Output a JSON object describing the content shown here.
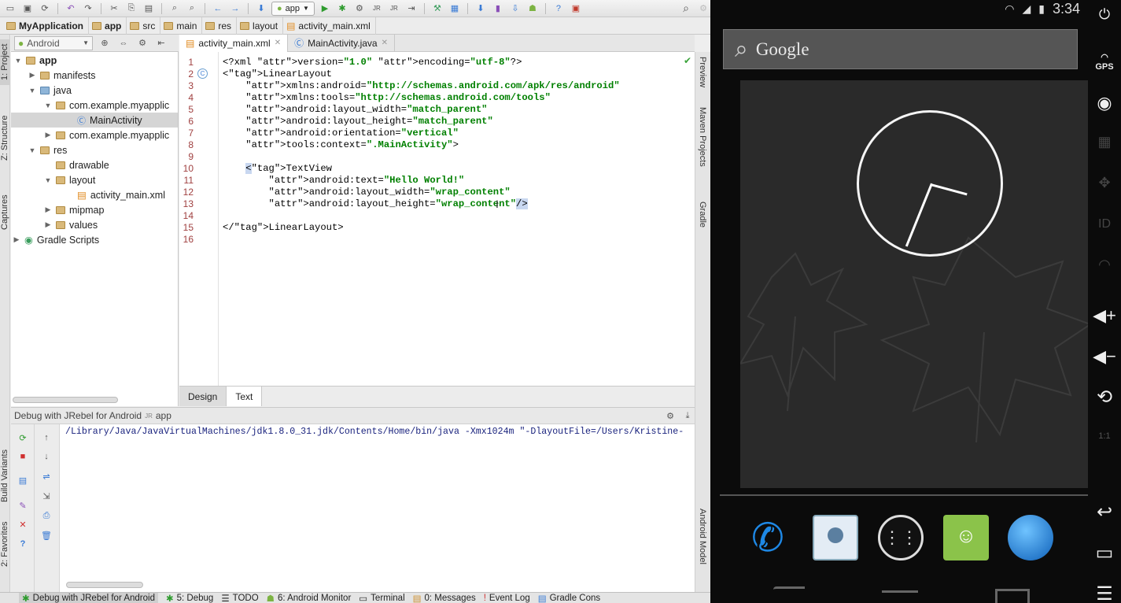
{
  "toolbar": {
    "run_config": "app"
  },
  "breadcrumb": [
    "MyApplication",
    "app",
    "src",
    "main",
    "res",
    "layout",
    "activity_main.xml"
  ],
  "left_stripe": {
    "project": "1: Project",
    "structure": "Z: Structure",
    "captures": "Captures",
    "build_variants": "Build Variants",
    "favorites": "2: Favorites"
  },
  "project_panel": {
    "view": "Android"
  },
  "tree": [
    {
      "label": "app",
      "bold": true,
      "depth": 0,
      "expand": "▼"
    },
    {
      "label": "manifests",
      "depth": 1,
      "expand": "▶"
    },
    {
      "label": "java",
      "depth": 1,
      "expand": "▼"
    },
    {
      "label": "com.example.myapplic",
      "depth": 2,
      "expand": "▼"
    },
    {
      "label": "MainActivity",
      "depth": 3,
      "expand": "",
      "selected": true
    },
    {
      "label": "com.example.myapplic",
      "depth": 2,
      "expand": "▶"
    },
    {
      "label": "res",
      "depth": 1,
      "expand": "▼"
    },
    {
      "label": "drawable",
      "depth": 2,
      "expand": ""
    },
    {
      "label": "layout",
      "depth": 2,
      "expand": "▼"
    },
    {
      "label": "activity_main.xml",
      "depth": 3,
      "expand": ""
    },
    {
      "label": "mipmap",
      "depth": 2,
      "expand": "▶"
    },
    {
      "label": "values",
      "depth": 2,
      "expand": "▶"
    },
    {
      "label": "Gradle Scripts",
      "depth": 0,
      "expand": "▶"
    }
  ],
  "editor_tabs": [
    "activity_main.xml",
    "MainActivity.java"
  ],
  "code_lines": [
    [
      "<?xml version=\"1.0\" encoding=\"utf-8\"?>"
    ],
    [
      "<LinearLayout"
    ],
    [
      "    xmlns:android=\"http://schemas.android.com/apk/res/android\""
    ],
    [
      "    xmlns:tools=\"http://schemas.android.com/tools\""
    ],
    [
      "    android:layout_width=\"match_parent\""
    ],
    [
      "    android:layout_height=\"match_parent\""
    ],
    [
      "    android:orientation=\"vertical\""
    ],
    [
      "    tools:context=\".MainActivity\">"
    ],
    [
      ""
    ],
    [
      "    <TextView"
    ],
    [
      "        android:text=\"Hello World!\""
    ],
    [
      "        android:layout_width=\"wrap_content\""
    ],
    [
      "        android:layout_height=\"wrap_content\"/>"
    ],
    [
      ""
    ],
    [
      "</LinearLayout>"
    ],
    [
      ""
    ]
  ],
  "editor_mode_tabs": [
    "Design",
    "Text"
  ],
  "right_stripe": {
    "preview": "Preview",
    "maven": "Maven Projects",
    "gradle": "Gradle",
    "android_model": "Android Model"
  },
  "debug": {
    "title": "Debug with JRebel for Android",
    "config": "app",
    "console_line": "/Library/Java/JavaVirtualMachines/jdk1.8.0_31.jdk/Contents/Home/bin/java -Xmx1024m \"-DlayoutFile=/Users/Kristine-"
  },
  "statusbar": [
    "Debug with JRebel for Android",
    "5: Debug",
    "TODO",
    "6: Android Monitor",
    "Terminal",
    "0: Messages",
    "Event Log",
    "Gradle Cons"
  ],
  "android": {
    "time": "3:34",
    "search_text": "Google",
    "side_gps": "GPS",
    "side_id": "ID"
  },
  "colors": {
    "xml_tag": "#000080",
    "xml_attr": "#660e7a",
    "xml_value": "#008000",
    "line_number": "#a04040"
  }
}
